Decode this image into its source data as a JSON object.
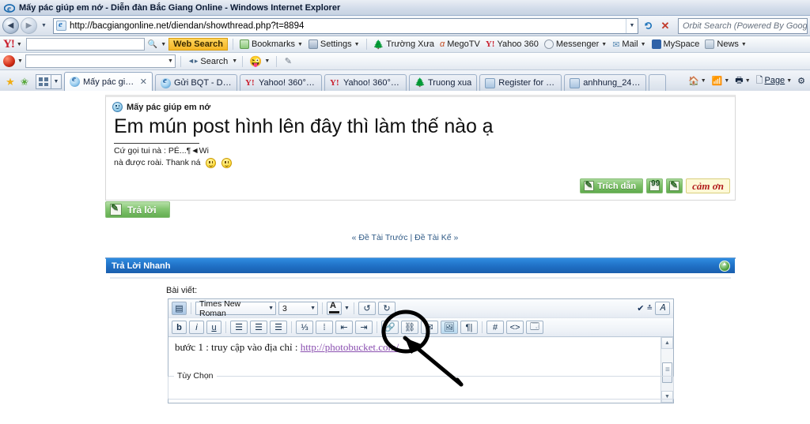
{
  "window": {
    "title": "Mấy pác giúp em nớ - Diễn đàn Bắc Giang Online - Windows Internet Explorer",
    "icon": "ie-logo-icon"
  },
  "address_bar": {
    "url": "http://bacgiangonline.net/diendan/showthread.php?t=8894",
    "back_icon": "back-arrow-icon",
    "forward_icon": "forward-arrow-icon",
    "history_caret": "chevron-down-icon",
    "refresh_icon": "refresh-icon",
    "stop_icon": "stop-icon",
    "orbit_search_placeholder": "Orbit Search (Powered By Google)"
  },
  "yahoo_toolbar": {
    "logo": "Y!",
    "search_value": "",
    "search_icon": "magnifier-icon",
    "web_search_label": "Web Search",
    "items": [
      {
        "label": "Bookmarks",
        "icon": "bookmark-icon",
        "caret": true
      },
      {
        "label": "Settings",
        "icon": "gear-icon",
        "caret": true
      },
      {
        "label": "Trường Xưa",
        "icon": "tree-icon",
        "caret": false
      },
      {
        "label": "MegoTV",
        "icon": "alpha-icon",
        "caret": false
      },
      {
        "label": "Yahoo 360",
        "icon": "yahoo-icon",
        "caret": false
      },
      {
        "label": "Messenger",
        "icon": "messenger-icon",
        "caret": true
      },
      {
        "label": "Mail",
        "icon": "mail-icon",
        "caret": true
      },
      {
        "label": "MySpace",
        "icon": "myspace-icon",
        "caret": false
      },
      {
        "label": "News",
        "icon": "news-icon",
        "caret": true
      }
    ]
  },
  "orbit_toolbar": {
    "logo_icon": "orbit-logo-icon",
    "input_value": "",
    "input_caret": "chevron-down-icon",
    "search_label": "Search",
    "search_caret": "chevron-down-icon",
    "smiley_icon": "emoticon-icon",
    "smiley_caret": "chevron-down-icon",
    "pen_icon": "pen-icon"
  },
  "tabbar": {
    "favorites_icon": "star-icon",
    "add_favorite_icon": "add-favorite-icon",
    "quick_tabs_icon": "quick-tabs-icon",
    "tab_list_caret": "chevron-down-icon",
    "tabs": [
      {
        "label": "Mấy pác giú...",
        "icon": "ie-icon",
        "active": true,
        "close": "✕"
      },
      {
        "label": "Gửi BQT - Diễn ...",
        "icon": "ie-icon",
        "active": false
      },
      {
        "label": "Yahoo! 360° - [...",
        "icon": "yahoo-icon",
        "active": false
      },
      {
        "label": "Yahoo! 360° - [...",
        "icon": "yahoo-icon",
        "active": false
      },
      {
        "label": "Truong xua",
        "icon": "tree-icon",
        "active": false
      },
      {
        "label": "Register for free...",
        "icon": "window-icon",
        "active": false
      },
      {
        "label": "anhhung_245 - ...",
        "icon": "window-icon",
        "active": false
      }
    ],
    "tools": [
      {
        "label": "",
        "icon": "home-icon",
        "caret": true
      },
      {
        "label": "",
        "icon": "feed-icon",
        "caret": true
      },
      {
        "label": "",
        "icon": "print-icon",
        "caret": true
      },
      {
        "label": "Page",
        "icon": "page-icon",
        "caret": true
      },
      {
        "label": "",
        "icon": "tools-gear-icon",
        "caret": false
      }
    ]
  },
  "post": {
    "thread_icon": "blue-smiley-icon",
    "thread_title": "Mấy pác giúp em nớ",
    "heading": "Em mún post hình lên đây thì làm thế nào ạ",
    "signature_line1": "Cứ gọi tui nà : PÉ...¶◄Wi",
    "signature_line2": "nà được roài. Thank ná",
    "emoticon_1": "yellow-smiley-icon",
    "emoticon_2": "yellow-smiley-icon",
    "actions": {
      "quote_label": "Trích dẫn",
      "quote_icon": "quote-pencil-icon",
      "multiquote_icon": "multiquote-icon",
      "edit_icon": "edit-pencil-icon",
      "thanks_label": "cảm ơn"
    }
  },
  "reply_button": {
    "label": "Trả lời",
    "icon": "reply-pencil-icon"
  },
  "thread_nav": {
    "prev_arrow": "«",
    "prev_label": "Đề Tài Trước",
    "divider": "|",
    "next_label": "Đề Tài Kế",
    "next_arrow": "»"
  },
  "quick_reply": {
    "header_title": "Trả Lời Nhanh",
    "collapse_icon": "collapse-icon",
    "field_label": "Bài viết:",
    "editor": {
      "toolbar_row1": {
        "switch_mode_icon": "switch-editor-icon",
        "font_family": "Times New Roman",
        "font_size": "3",
        "color_icon": "font-color-icon",
        "undo_icon": "undo-icon",
        "redo_icon": "redo-icon",
        "spellcheck_icon": "spellcheck-icon",
        "updown_icon": "increase-decrease-icon",
        "remove_format_icon": "remove-format-icon"
      },
      "toolbar_row2": {
        "bold": "b",
        "italic": "i",
        "underline": "u",
        "align_left_icon": "align-left-icon",
        "align_center_icon": "align-center-icon",
        "align_right_icon": "align-right-icon",
        "ordered_list_icon": "ordered-list-icon",
        "unordered_list_icon": "unordered-list-icon",
        "outdent_icon": "outdent-icon",
        "indent_icon": "indent-icon",
        "link_icon": "insert-link-icon",
        "unlink_icon": "remove-link-icon",
        "email_icon": "insert-email-icon",
        "image_icon": "insert-image-icon",
        "video_icon": "insert-video-icon",
        "quote_icon": "insert-quote-icon",
        "code_icon": "insert-code-icon",
        "php_icon": "insert-php-icon"
      },
      "content_text": "bước 1 : truy cập vào địa chỉ : ",
      "content_link": "http://photobucket.com/",
      "scrollbar": {
        "up_icon": "scroll-up-icon",
        "down_icon": "scroll-down-icon",
        "thumb": "scroll-thumb"
      }
    },
    "options_label": "Tùy Chọn"
  },
  "annotation": {
    "circle": "hand-drawn-circle-highlight",
    "arrow": "hand-drawn-arrow-pointer",
    "color": "#000000"
  },
  "colors": {
    "panel_header_blue": "#1f6fc4",
    "green_button": "#63ad50",
    "link_purple": "#8a4fb0",
    "nav_link_blue": "#2f5a86",
    "websearch_yellow": "#f5b726"
  }
}
